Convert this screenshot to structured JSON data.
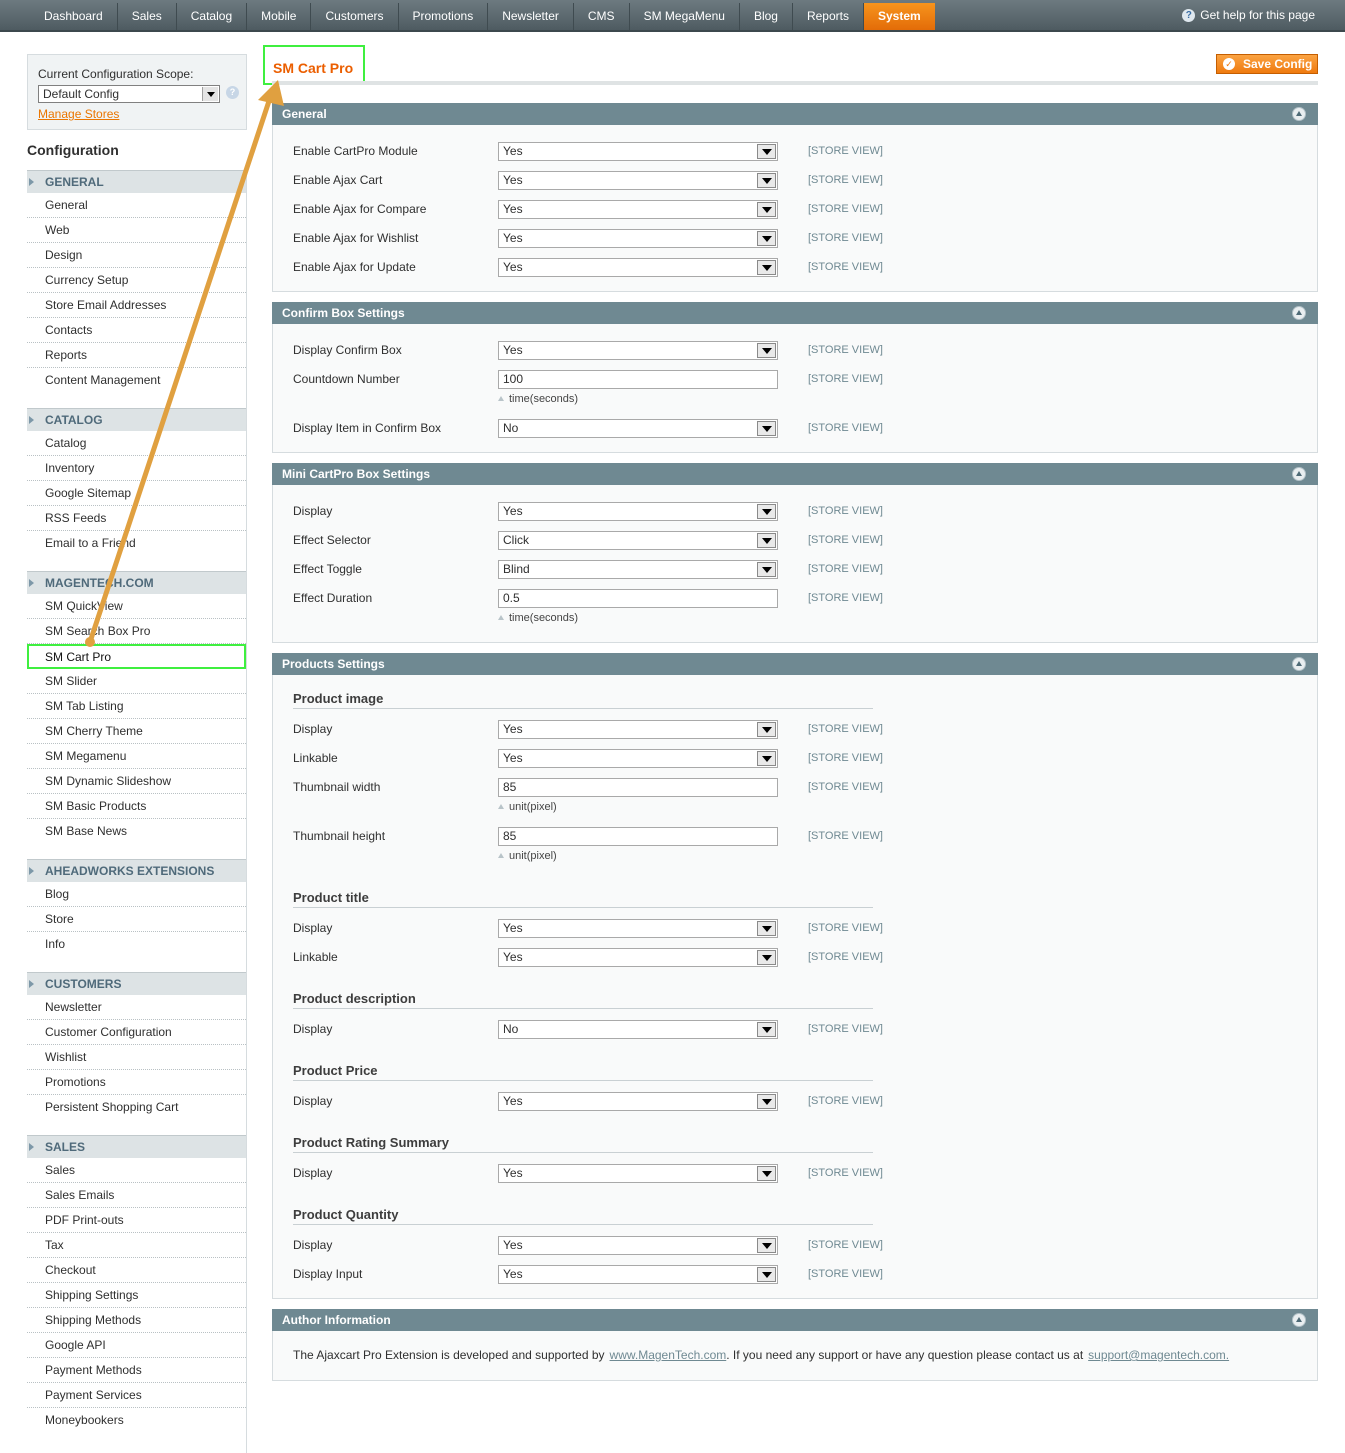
{
  "nav": {
    "items": [
      "Dashboard",
      "Sales",
      "Catalog",
      "Mobile",
      "Customers",
      "Promotions",
      "Newsletter",
      "CMS",
      "SM MegaMenu",
      "Blog",
      "Reports",
      "System"
    ],
    "active": "System",
    "help_label": "Get help for this page"
  },
  "scope": {
    "label": "Current Configuration Scope:",
    "value": "Default Config",
    "manage_label": "Manage Stores"
  },
  "sidebar": {
    "title": "Configuration",
    "groups": [
      {
        "title": "GENERAL",
        "items": [
          "General",
          "Web",
          "Design",
          "Currency Setup",
          "Store Email Addresses",
          "Contacts",
          "Reports",
          "Content Management"
        ]
      },
      {
        "title": "CATALOG",
        "items": [
          "Catalog",
          "Inventory",
          "Google Sitemap",
          "RSS Feeds",
          "Email to a Friend"
        ]
      },
      {
        "title": "MAGENTECH.COM",
        "items": [
          "SM QuickView",
          "SM Search Box Pro",
          "SM Cart Pro",
          "SM Slider",
          "SM Tab Listing",
          "SM Cherry Theme",
          "SM Megamenu",
          "SM Dynamic Slideshow",
          "SM Basic Products",
          "SM Base News"
        ]
      },
      {
        "title": "AHEADWORKS EXTENSIONS",
        "items": [
          "Blog",
          "Store",
          "Info"
        ]
      },
      {
        "title": "CUSTOMERS",
        "items": [
          "Newsletter",
          "Customer Configuration",
          "Wishlist",
          "Promotions",
          "Persistent Shopping Cart"
        ]
      },
      {
        "title": "SALES",
        "items": [
          "Sales",
          "Sales Emails",
          "PDF Print-outs",
          "Tax",
          "Checkout",
          "Shipping Settings",
          "Shipping Methods",
          "Google API",
          "Payment Methods",
          "Payment Services",
          "Moneybookers"
        ]
      }
    ],
    "active_item": "SM Cart Pro"
  },
  "page": {
    "title": "SM Cart Pro",
    "save_label": "Save Config",
    "scope_tag": "[STORE VIEW]"
  },
  "general": {
    "title": "General",
    "fields": [
      {
        "label": "Enable CartPro Module",
        "value": "Yes"
      },
      {
        "label": "Enable Ajax Cart",
        "value": "Yes"
      },
      {
        "label": "Enable Ajax for Compare",
        "value": "Yes"
      },
      {
        "label": "Enable Ajax for Wishlist",
        "value": "Yes"
      },
      {
        "label": "Enable Ajax for Update",
        "value": "Yes"
      }
    ]
  },
  "confirm": {
    "title": "Confirm Box Settings",
    "display_label": "Display Confirm Box",
    "display_value": "Yes",
    "countdown_label": "Countdown Number",
    "countdown_value": "100",
    "countdown_note": "time(seconds)",
    "item_label": "Display Item in Confirm Box",
    "item_value": "No"
  },
  "mini": {
    "title": "Mini CartPro Box Settings",
    "display_label": "Display",
    "display_value": "Yes",
    "selector_label": "Effect Selector",
    "selector_value": "Click",
    "toggle_label": "Effect Toggle",
    "toggle_value": "Blind",
    "duration_label": "Effect Duration",
    "duration_value": "0.5",
    "duration_note": "time(seconds)"
  },
  "products": {
    "title": "Products Settings",
    "image_head": "Product image",
    "image_display_label": "Display",
    "image_display_value": "Yes",
    "image_link_label": "Linkable",
    "image_link_value": "Yes",
    "thumb_w_label": "Thumbnail width",
    "thumb_w_value": "85",
    "thumb_w_note": "unit(pixel)",
    "thumb_h_label": "Thumbnail height",
    "thumb_h_value": "85",
    "thumb_h_note": "unit(pixel)",
    "title_head": "Product title",
    "title_display_label": "Display",
    "title_display_value": "Yes",
    "title_link_label": "Linkable",
    "title_link_value": "Yes",
    "desc_head": "Product description",
    "desc_display_label": "Display",
    "desc_display_value": "No",
    "price_head": "Product Price",
    "price_display_label": "Display",
    "price_display_value": "Yes",
    "rating_head": "Product Rating Summary",
    "rating_display_label": "Display",
    "rating_display_value": "Yes",
    "qty_head": "Product Quantity",
    "qty_display_label": "Display",
    "qty_display_value": "Yes",
    "qty_input_label": "Display Input",
    "qty_input_value": "Yes"
  },
  "author": {
    "title": "Author Information",
    "text1": "The Ajaxcart Pro Extension is developed and supported by",
    "link1": "www.MagenTech.com",
    "text2": ". If you need any support or have any question please contact us at",
    "link2": "support@magentech.com."
  },
  "colors": {
    "nav_active": "#e36c08",
    "section_header": "#6f8992",
    "highlight": "#3fef3f",
    "annotation_arrow": "#e0a040",
    "title": "#eb5e00"
  }
}
